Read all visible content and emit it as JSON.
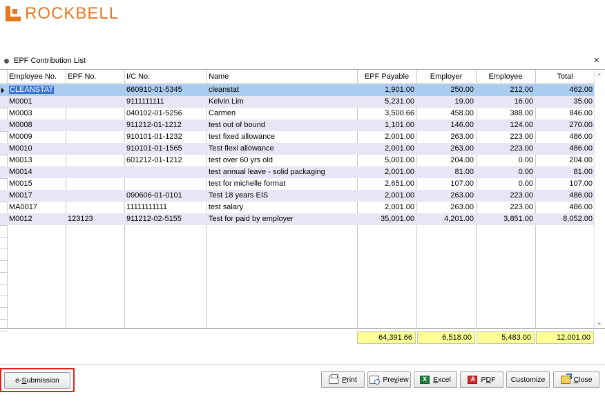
{
  "brand": {
    "name": "ROCKBELL",
    "color": "#e87722"
  },
  "panel": {
    "title": "EPF Contribution List",
    "close_label": "×"
  },
  "columns": [
    {
      "key": "emp_no",
      "label": "Employee No."
    },
    {
      "key": "epf_no",
      "label": "EPF No."
    },
    {
      "key": "ic_no",
      "label": "I/C No."
    },
    {
      "key": "name",
      "label": "Name"
    },
    {
      "key": "epf_payable",
      "label": "EPF Payable"
    },
    {
      "key": "employer",
      "label": "Employer"
    },
    {
      "key": "employee",
      "label": "Employee"
    },
    {
      "key": "total",
      "label": "Total"
    }
  ],
  "rows": [
    {
      "emp_no": "CLEANSTAT",
      "epf_no": "",
      "ic_no": "660910-01-5345",
      "name": "cleanstat",
      "epf_payable": "1,901.00",
      "employer": "250.00",
      "employee": "212.00",
      "total": "462.00"
    },
    {
      "emp_no": "M0001",
      "epf_no": "",
      "ic_no": "9111111111",
      "name": "Kelvin Lim",
      "epf_payable": "5,231.00",
      "employer": "19.00",
      "employee": "16.00",
      "total": "35.00"
    },
    {
      "emp_no": "M0003",
      "epf_no": "",
      "ic_no": "040102-01-5256",
      "name": "Carmen",
      "epf_payable": "3,500.66",
      "employer": "458.00",
      "employee": "388.00",
      "total": "846.00"
    },
    {
      "emp_no": "M0008",
      "epf_no": "",
      "ic_no": "911212-01-1212",
      "name": "test out of bound",
      "epf_payable": "1,101.00",
      "employer": "146.00",
      "employee": "124.00",
      "total": "270.00"
    },
    {
      "emp_no": "M0009",
      "epf_no": "",
      "ic_no": "910101-01-1232",
      "name": "test fixed allowance",
      "epf_payable": "2,001.00",
      "employer": "263.00",
      "employee": "223.00",
      "total": "486.00"
    },
    {
      "emp_no": "M0010",
      "epf_no": "",
      "ic_no": "910101-01-1565",
      "name": "Test flexi allowance",
      "epf_payable": "2,001.00",
      "employer": "263.00",
      "employee": "223.00",
      "total": "486.00"
    },
    {
      "emp_no": "M0013",
      "epf_no": "",
      "ic_no": "601212-01-1212",
      "name": "test over 60 yrs old",
      "epf_payable": "5,001.00",
      "employer": "204.00",
      "employee": "0.00",
      "total": "204.00"
    },
    {
      "emp_no": "M0014",
      "epf_no": "",
      "ic_no": "",
      "name": "test annual leave - solid packaging",
      "epf_payable": "2,001.00",
      "employer": "81.00",
      "employee": "0.00",
      "total": "81.00"
    },
    {
      "emp_no": "M0015",
      "epf_no": "",
      "ic_no": "",
      "name": "test for michelle format",
      "epf_payable": "2,651.00",
      "employer": "107.00",
      "employee": "0.00",
      "total": "107.00"
    },
    {
      "emp_no": "M0017",
      "epf_no": "",
      "ic_no": "090606-01-0101",
      "name": "Test 18 years EIS",
      "epf_payable": "2,001.00",
      "employer": "263.00",
      "employee": "223.00",
      "total": "486.00"
    },
    {
      "emp_no": "MA0017",
      "epf_no": "",
      "ic_no": "11111111111",
      "name": "test salary",
      "epf_payable": "2,001.00",
      "employer": "263.00",
      "employee": "223.00",
      "total": "486.00"
    },
    {
      "emp_no": "M0012",
      "epf_no": "123123",
      "ic_no": "911212-02-5155",
      "name": "Test for paid by employer",
      "epf_payable": "35,001.00",
      "employer": "4,201.00",
      "employee": "3,851.00",
      "total": "8,052.00"
    }
  ],
  "totals": {
    "epf_payable": "64,391.66",
    "employer": "6,518.00",
    "employee": "5,483.00",
    "total": "12,001.00"
  },
  "buttons": {
    "esubmission": {
      "pre": "e-",
      "key": "S",
      "post": "ubmission"
    },
    "print": {
      "pre": "",
      "key": "P",
      "post": "rint"
    },
    "preview": {
      "pre": "Pre",
      "key": "v",
      "post": "iew"
    },
    "excel": {
      "pre": "",
      "key": "E",
      "post": "xcel"
    },
    "pdf": {
      "pre": "P",
      "key": "D",
      "post": "F"
    },
    "customize": {
      "pre": "Customize",
      "key": "",
      "post": ""
    },
    "close": {
      "pre": "",
      "key": "C",
      "post": "lose"
    }
  },
  "selected_row": 0
}
